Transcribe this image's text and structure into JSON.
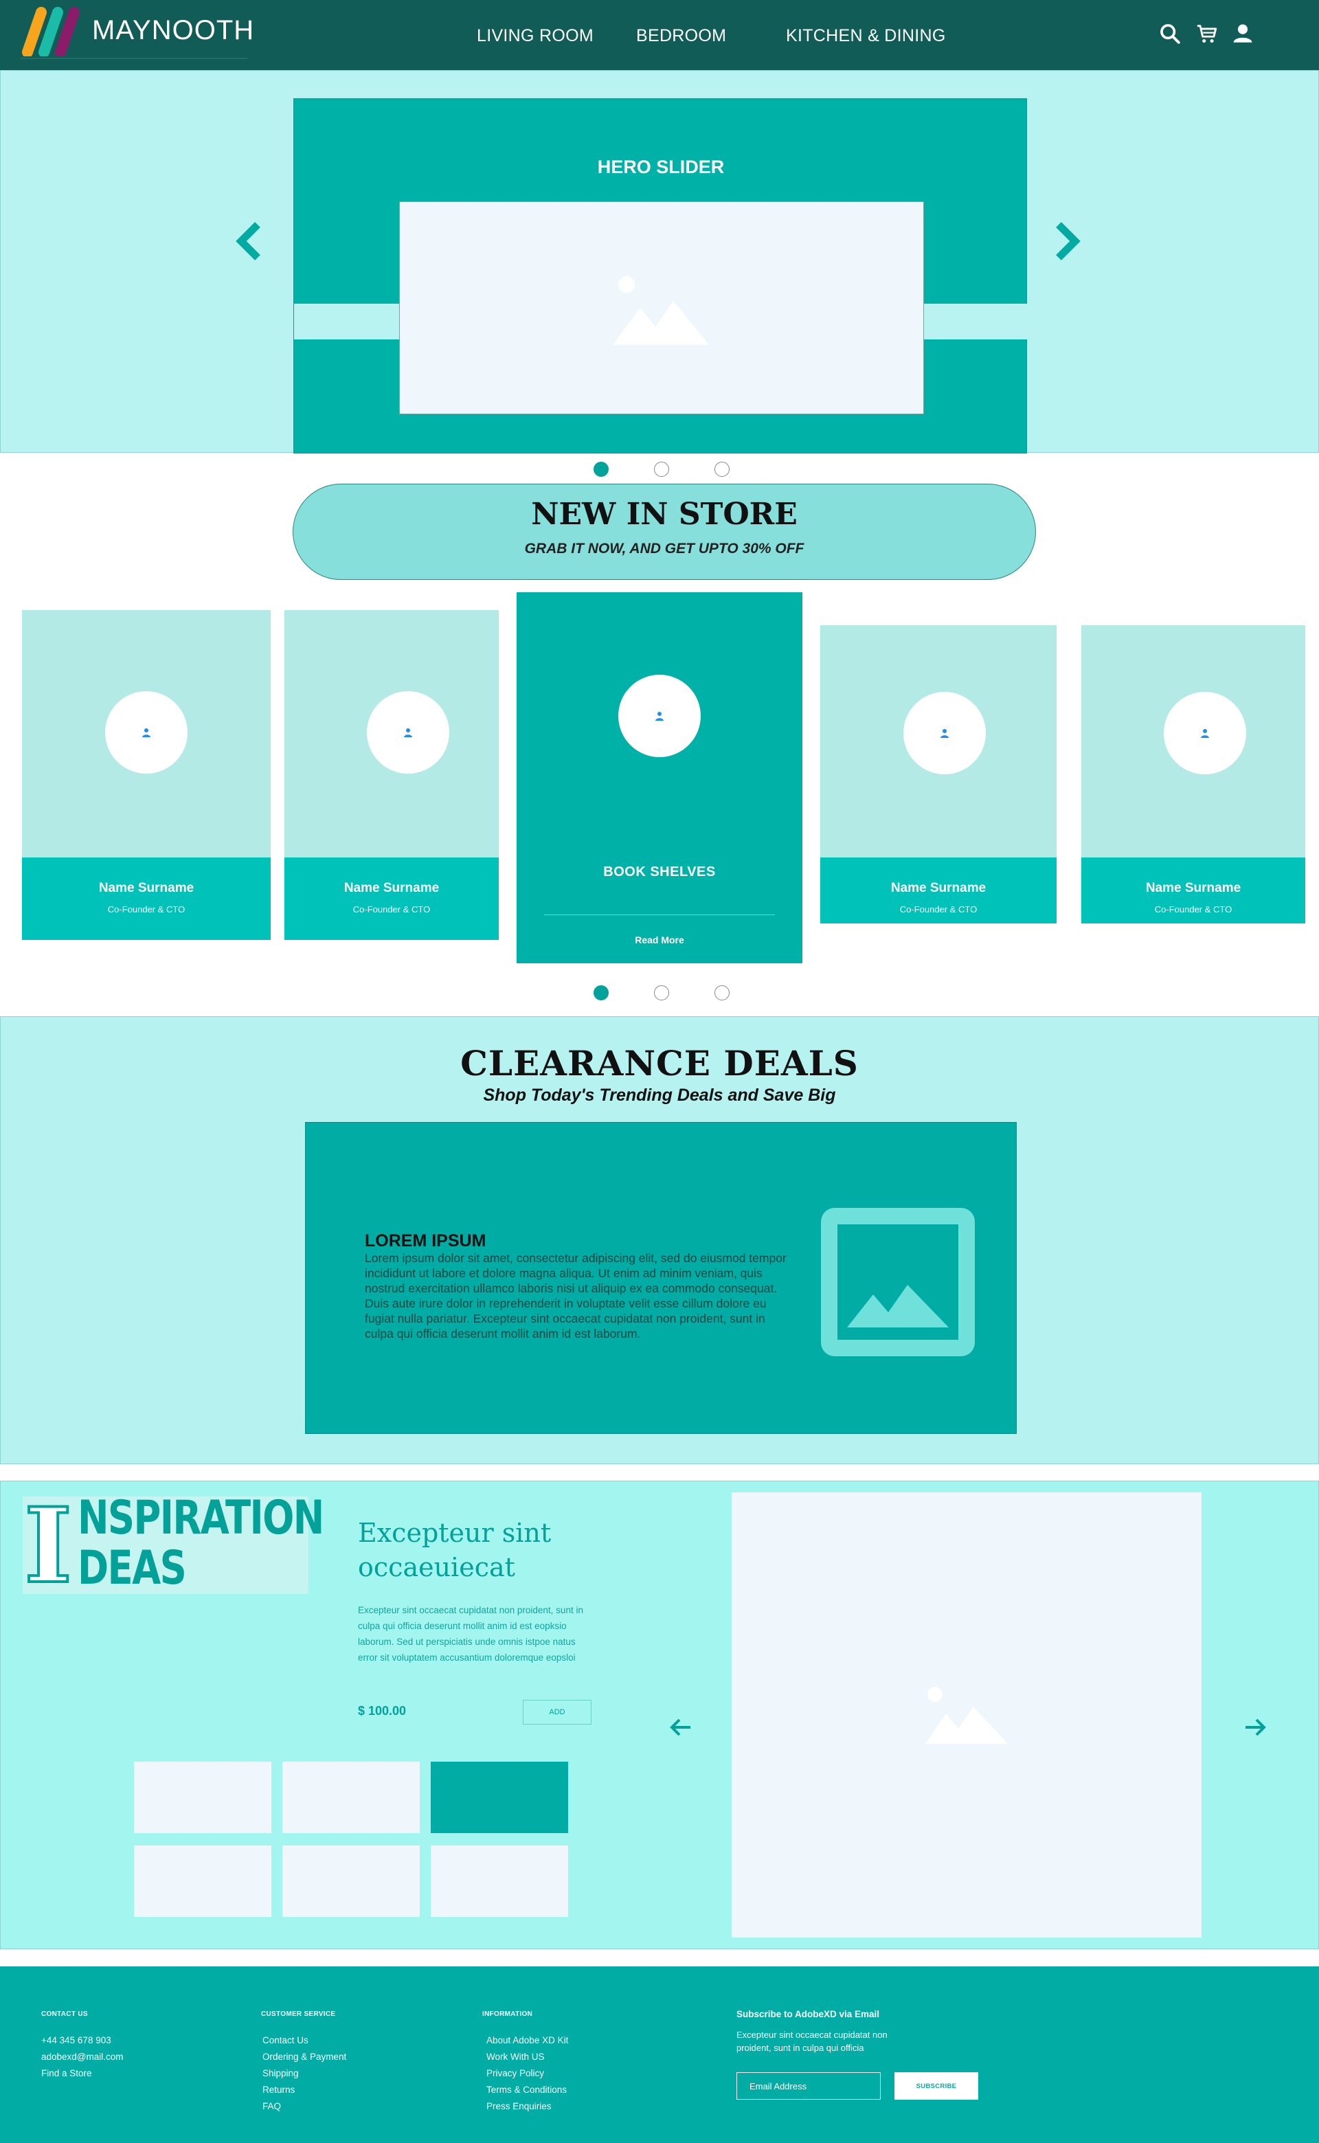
{
  "header": {
    "brand": "MAYNOOTH",
    "nav": [
      "LIVING ROOM",
      "BEDROOM",
      "KITCHEN & DINING"
    ],
    "icons": [
      "search-icon",
      "cart-icon",
      "user-icon"
    ]
  },
  "hero": {
    "title": "HERO SLIDER",
    "slide_count": 3,
    "active_slide": 1
  },
  "new_in_store": {
    "title": "NEW IN STORE",
    "subtitle": "GRAB IT NOW, AND GET UPTO 30% OFF",
    "cards": [
      {
        "name": "Name Surname",
        "role": "Co-Founder & CTO"
      },
      {
        "name": "Name Surname",
        "role": "Co-Founder & CTO"
      },
      {
        "name": "Name Surname",
        "role": "Co-Founder & CTO"
      },
      {
        "name": "Name Surname",
        "role": "Co-Founder & CTO"
      }
    ],
    "featured": {
      "title": "BOOK SHELVES",
      "link": "Read More"
    },
    "slide_count": 3,
    "active_slide": 1
  },
  "clearance": {
    "title": "CLEARANCE DEALS",
    "subtitle": "Shop Today's Trending Deals and Save Big",
    "card_heading": "LOREM IPSUM",
    "card_body": "Lorem ipsum dolor sit amet, consectetur adipiscing elit, sed do eiusmod tempor incididunt ut labore et dolore magna aliqua. Ut enim ad minim veniam, quis nostrud exercitation ullamco laboris nisi ut aliquip ex ea commodo consequat. Duis aute irure dolor in reprehenderit in voluptate velit esse cillum dolore eu fugiat nulla pariatur. Excepteur sint occaecat cupidatat non proident, sunt in culpa qui officia deserunt mollit anim id est laborum."
  },
  "inspiration": {
    "logo_initial": "I",
    "logo_line1": "NSPIRATION",
    "logo_line2": "DEAS",
    "heading": "Excepteur sint occaeuiecat",
    "text": "Excepteur sint occaecat cupidatat non proident, sunt in culpa qui officia deserunt mollit anim id est eopksio laborum. Sed ut perspiciatis unde omnis istpoe natus error sit voluptatem accusantium doloremque eopsloi",
    "price": "$ 100.00",
    "add_label": "ADD",
    "thumbs_active": 3
  },
  "footer": {
    "contact": {
      "heading": "CONTACT US",
      "items": [
        "+44 345 678 903",
        "adobexd@mail.com",
        "Find a Store"
      ]
    },
    "service": {
      "heading": "CUSTOMER SERVICE",
      "items": [
        "Contact Us",
        "Ordering & Payment",
        "Shipping",
        "Returns",
        "FAQ"
      ]
    },
    "info": {
      "heading": "INFORMATION",
      "items": [
        "About Adobe XD Kit",
        "Work With US",
        "Privacy Policy",
        "Terms & Conditions",
        "Press Enquiries"
      ]
    },
    "subscribe": {
      "heading": "Subscribe to AdobeXD via Email",
      "text": "Excepteur sint occaecat cupidatat non proident, sunt in culpa qui officia",
      "placeholder": "Email Address",
      "button": "SUBSCRIBE"
    }
  },
  "colors": {
    "header": "#115c56",
    "accent": "#00b1a8",
    "hero_bg": "#b8f3f1",
    "footer": "#00aca3"
  }
}
